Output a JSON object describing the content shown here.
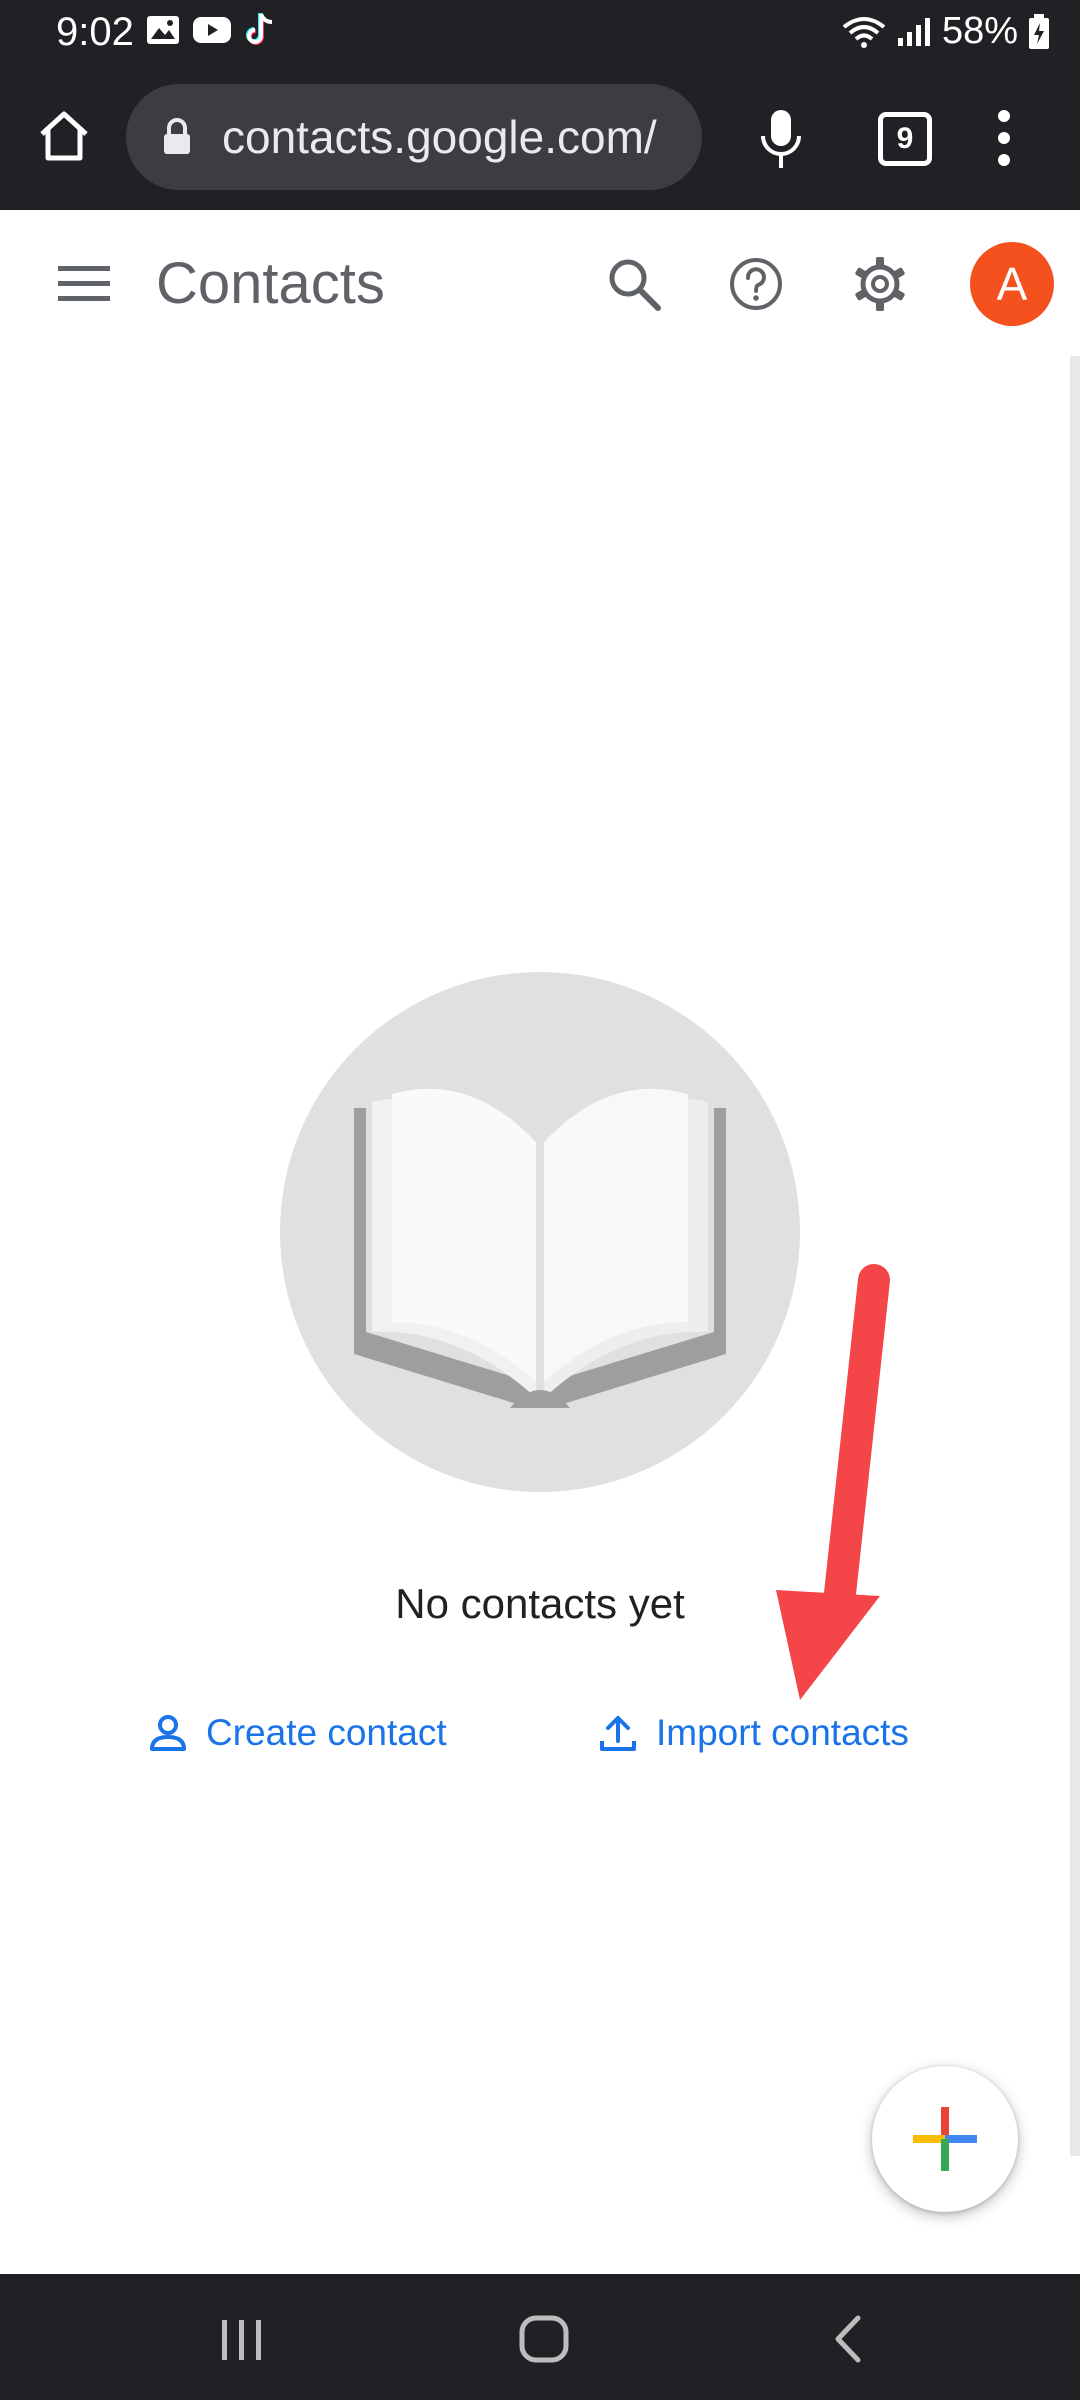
{
  "status_bar": {
    "time": "9:02",
    "battery": "58%",
    "notification_icons": [
      "gallery-icon",
      "youtube-icon",
      "tiktok-icon"
    ]
  },
  "browser": {
    "url": "contacts.google.com/",
    "tab_count": "9"
  },
  "app": {
    "title": "Contacts",
    "avatar_letter": "A",
    "avatar_color": "#f4511e"
  },
  "empty_state": {
    "message": "No contacts yet",
    "create_label": "Create contact",
    "import_label": "Import contacts"
  },
  "colors": {
    "link": "#1a73e8",
    "annotation_arrow": "#f44649",
    "fab_red": "#ea4335",
    "fab_blue": "#4285f4",
    "fab_yellow": "#fbbc04",
    "fab_green": "#34a853"
  }
}
